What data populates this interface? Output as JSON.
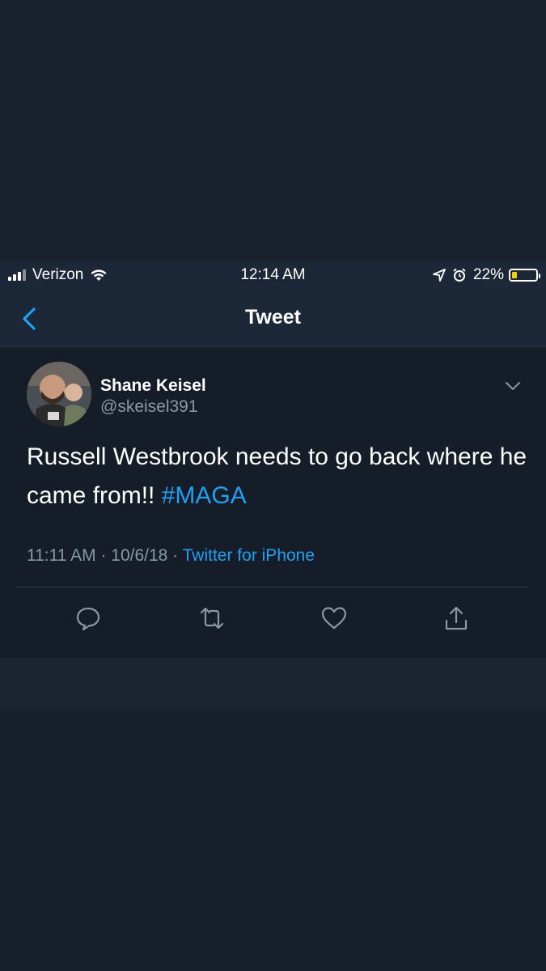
{
  "status_bar": {
    "carrier": "Verizon",
    "time": "12:14 AM",
    "battery_percent_label": "22%",
    "battery_level": 0.22,
    "battery_color": "#f5d100"
  },
  "nav": {
    "title": "Tweet",
    "back_icon": "chevron-left-icon"
  },
  "tweet": {
    "author_name": "Shane Keisel",
    "author_handle": "@skeisel391",
    "text_before_hashtag": "Russell Westbrook needs to go back where he came from!! ",
    "hashtag": "#MAGA",
    "time": "11:11 AM · 10/6/18 · ",
    "source": "Twitter for iPhone",
    "actions": [
      "reply-icon",
      "retweet-icon",
      "like-icon",
      "share-icon"
    ]
  },
  "colors": {
    "accent": "#1da1f2",
    "background": "#151d28",
    "secondary_text": "#8899a6"
  }
}
